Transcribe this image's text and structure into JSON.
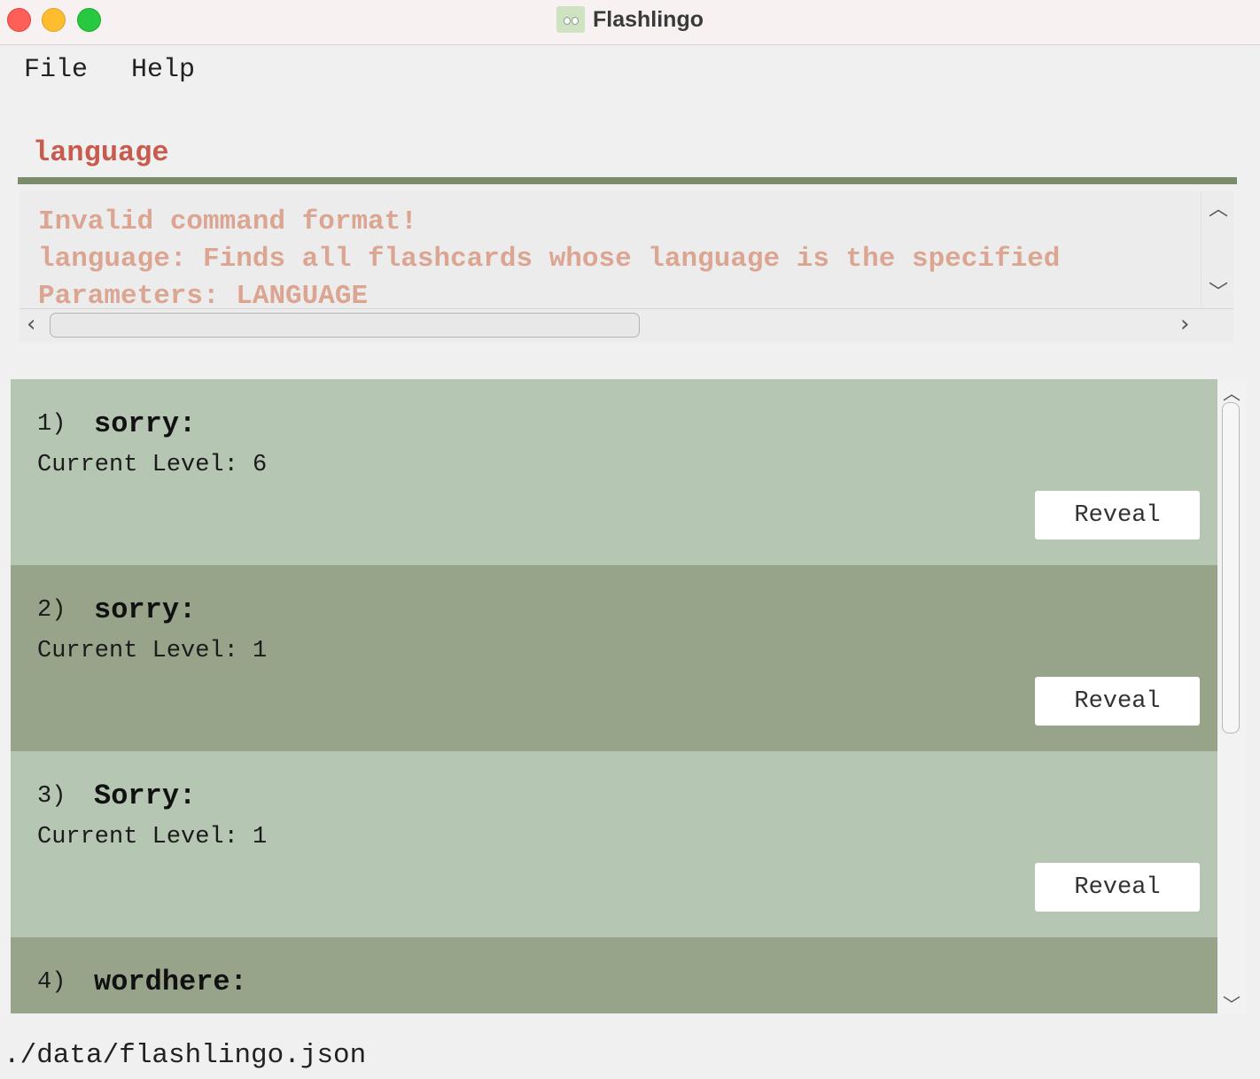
{
  "window": {
    "title": "Flashlingo",
    "app_icon": "flashlingo-logo"
  },
  "menu": {
    "items": [
      "File",
      "Help"
    ]
  },
  "command_box": {
    "text": "language"
  },
  "result_display": {
    "lines": [
      "Invalid command format!",
      "language: Finds all flashcards whose language is the specified",
      "Parameters: LANGUAGE"
    ]
  },
  "flashcards": [
    {
      "index": "1)",
      "word": "sorry:",
      "level": "Current Level: 6",
      "button": "Reveal"
    },
    {
      "index": "2)",
      "word": "sorry:",
      "level": "Current Level: 1",
      "button": "Reveal"
    },
    {
      "index": "3)",
      "word": "Sorry:",
      "level": "Current Level: 1",
      "button": "Reveal"
    },
    {
      "index": "4)",
      "word": "wordhere:",
      "level": "",
      "button": ""
    }
  ],
  "status_bar": {
    "path": "./data/flashlingo.json"
  },
  "colors": {
    "command_text": "#c85b4d",
    "result_text": "#dba592",
    "card_light": "#b5c6b2",
    "card_dark": "#97a48a",
    "separator": "#7a8c6c"
  }
}
